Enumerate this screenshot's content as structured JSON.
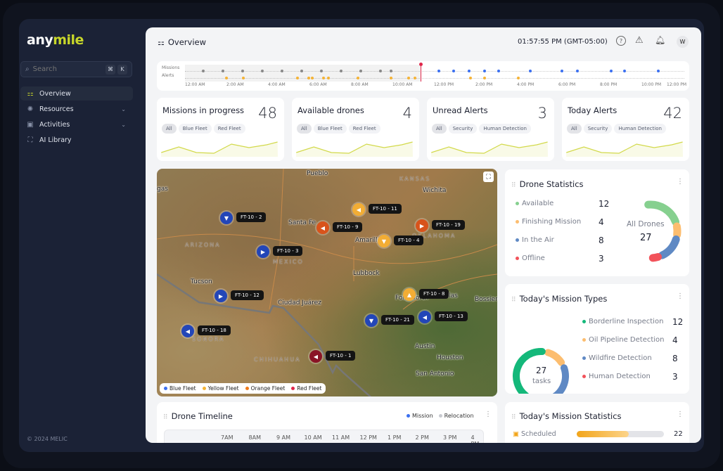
{
  "app": {
    "logo_part1": "any",
    "logo_part2": "mile",
    "copyright": "© 2024 MELIC",
    "accent": "#c7d62a"
  },
  "search": {
    "placeholder": "Search",
    "shortcut_key1": "⌘",
    "shortcut_key2": "K"
  },
  "sidebar": {
    "items": [
      {
        "label": "Overview",
        "icon": "grid-icon",
        "active": true
      },
      {
        "label": "Resources",
        "icon": "sun-icon",
        "expandable": true
      },
      {
        "label": "Activities",
        "icon": "clipboard-icon",
        "expandable": true
      },
      {
        "label": "AI Library",
        "icon": "scan-icon"
      }
    ]
  },
  "header": {
    "title": "Overview",
    "time": "01:57:55 PM (GMT-05:00)",
    "avatar": "W"
  },
  "timeline": {
    "row_labels": [
      "Missions",
      "Alerts"
    ],
    "ticks": [
      "12:00 AM",
      "2:00 AM",
      "4:00 AM",
      "6:00 AM",
      "8:00 AM",
      "10:00 AM",
      "12:00 PM",
      "2:00 PM",
      "4:00 PM",
      "6:00 PM",
      "8:00 PM",
      "10:00 PM",
      "12:00 PM"
    ],
    "now_hours": 11.36,
    "past_missions_hours": [
      0.88,
      1.83,
      2.78,
      3.73,
      4.68,
      5.63,
      6.58,
      7.53,
      8.47,
      9.42,
      9.93
    ],
    "future_missions_hours": [
      12.24,
      12.95,
      13.69,
      14.44,
      15.12,
      16.64,
      18.17,
      18.92,
      20.54,
      21.19,
      22.81
    ],
    "alerts_hours": [
      2.0,
      2.81,
      5.42,
      5.97,
      6.14,
      6.68,
      6.92,
      8.34,
      9.93,
      10.78,
      11.08,
      13.76,
      14.44,
      16.07
    ]
  },
  "kpis": [
    {
      "title": "Missions in progress",
      "value": "48",
      "chips": [
        "All",
        "Blue Fleet",
        "Red Fleet"
      ]
    },
    {
      "title": "Available drones",
      "value": "4",
      "chips": [
        "All",
        "Blue Fleet",
        "Red Fleet"
      ]
    },
    {
      "title": "Unread Alerts",
      "value": "3",
      "chips": [
        "All",
        "Security",
        "Human Detection"
      ]
    },
    {
      "title": "Today Alerts",
      "value": "42",
      "chips": [
        "All",
        "Security",
        "Human Detection"
      ]
    }
  ],
  "map": {
    "cities": [
      "Pueblo",
      "Wichita",
      "Santa Fe",
      "Amarillo",
      "Lubbock",
      "Tucson",
      "Ciudad Juárez",
      "Fort Worth",
      "Dallas",
      "Bossier",
      "Austin",
      "Houston",
      "San Antonio",
      "gas"
    ],
    "regions": [
      "KANSAS",
      "ARIZONA",
      "OKLAHOMA",
      "MEXICO",
      "SONORA",
      "CHIHUAHUA"
    ],
    "drones": [
      {
        "id": "FT-10 - 2",
        "fleet": "blue",
        "dir": "down"
      },
      {
        "id": "FT-10 - 3",
        "fleet": "blue",
        "dir": "right"
      },
      {
        "id": "FT-10 - 12",
        "fleet": "blue",
        "dir": "right"
      },
      {
        "id": "FT-10 - 18",
        "fleet": "blue",
        "dir": "left"
      },
      {
        "id": "FT-10 - 9",
        "fleet": "orange",
        "dir": "left"
      },
      {
        "id": "FT-10 - 11",
        "fleet": "yellow",
        "dir": "left"
      },
      {
        "id": "FT-10 - 19",
        "fleet": "orange",
        "dir": "right"
      },
      {
        "id": "FT-10 - 4",
        "fleet": "yellow",
        "dir": "down"
      },
      {
        "id": "FT-10 - 8",
        "fleet": "yellow",
        "dir": "up"
      },
      {
        "id": "FT-10 - 21",
        "fleet": "blue",
        "dir": "down"
      },
      {
        "id": "FT-10 - 13",
        "fleet": "blue",
        "dir": "left"
      },
      {
        "id": "FT-10 - 1",
        "fleet": "red",
        "dir": "left"
      }
    ],
    "legend": [
      {
        "label": "Blue Fleet",
        "color": "#3b6ff0"
      },
      {
        "label": "Yellow Fleet",
        "color": "#f5b335"
      },
      {
        "label": "Orange Fleet",
        "color": "#f07a1a"
      },
      {
        "label": "Red Fleet",
        "color": "#e0264a"
      }
    ],
    "fleet_colors": {
      "blue": "#2346b8",
      "yellow": "#f2ad35",
      "orange": "#d8531b",
      "red": "#8a1426"
    }
  },
  "drone_stats": {
    "title": "Drone Statistics",
    "center_label": "All Drones",
    "total": "27",
    "items": [
      {
        "label": "Available",
        "value": "12",
        "color": "#86d08f"
      },
      {
        "label": "Finishing Mission",
        "value": "4",
        "color": "#fcbd6f"
      },
      {
        "label": "In the Air",
        "value": "8",
        "color": "#5f89c4"
      },
      {
        "label": "Offline",
        "value": "3",
        "color": "#f2525a"
      }
    ]
  },
  "mission_types": {
    "title": "Today's Mission Types",
    "total": "27",
    "unit": "tasks",
    "items": [
      {
        "label": "Borderline Inspection",
        "value": "12",
        "color": "#14b87a"
      },
      {
        "label": "Oil Pipeline Detection",
        "value": "4",
        "color": "#fcbd6f"
      },
      {
        "label": "Wildfire Detection",
        "value": "8",
        "color": "#5f89c4"
      },
      {
        "label": "Human Detection",
        "value": "3",
        "color": "#f2525a"
      }
    ]
  },
  "drone_timeline": {
    "title": "Drone Timeline",
    "legend": [
      {
        "label": "Mission",
        "color": "#3b6ff0"
      },
      {
        "label": "Relocation",
        "color": "#c8cad0"
      }
    ],
    "hours": [
      "7AM",
      "8AM",
      "9 AM",
      "10 AM",
      "11 AM",
      "12 PM",
      "1 PM",
      "2 PM",
      "3 PM",
      "4 PM"
    ]
  },
  "mission_stats": {
    "title": "Today's Mission Statistics",
    "rows": [
      {
        "label": "Scheduled",
        "value": "22",
        "progress": 0.6
      }
    ]
  }
}
